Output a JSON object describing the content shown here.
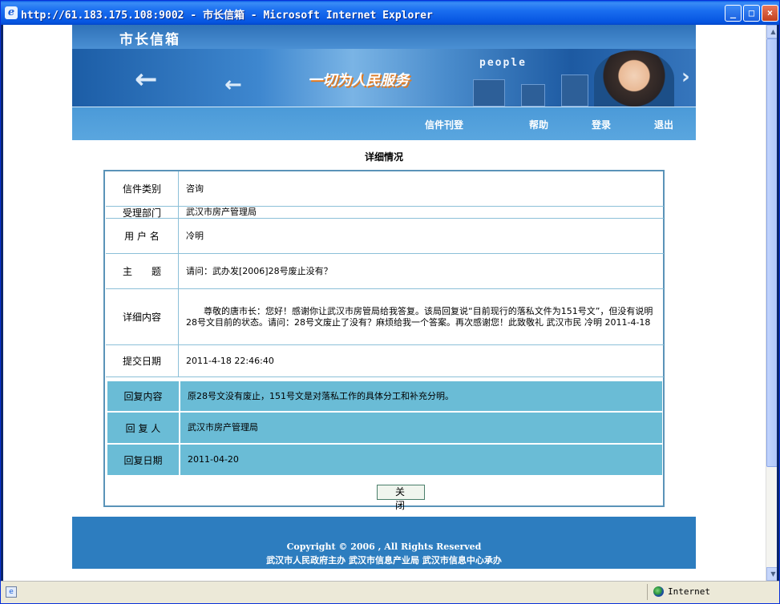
{
  "window": {
    "title": "http://61.183.175.108:9002 - 市长信箱 - Microsoft Internet Explorer",
    "min_label": "_",
    "max_label": "□",
    "close_label": "×"
  },
  "banner": {
    "site_title": "市长信箱",
    "slogan": "一切为人民服务",
    "people_text": "people"
  },
  "nav": {
    "items": [
      {
        "label": "信件刊登"
      },
      {
        "label": "帮助"
      },
      {
        "label": "登录"
      },
      {
        "label": "退出"
      }
    ]
  },
  "detail": {
    "heading": "详细情况",
    "rows": [
      {
        "label": "信件类别",
        "value": "咨询"
      },
      {
        "label": "受理部门",
        "value": "武汉市房产管理局"
      },
      {
        "label": "用 户 名",
        "value": "冷明"
      },
      {
        "label": "主　　题",
        "value": "请问：武办发[2006]28号废止没有？"
      },
      {
        "label": "详细内容",
        "value": "　　尊敬的唐市长：您好！感谢你让武汉市房管局给我答复。该局回复说“目前现行的落私文件为151号文”，但没有说明28号文目前的状态。请问：28号文废止了没有？麻烦给我一个答案。再次感谢您！此致敬礼 武汉市民 冷明 2011-4-18"
      },
      {
        "label": "提交日期",
        "value": "2011-4-18 22:46:40"
      }
    ],
    "replies": [
      {
        "label": "回复内容",
        "value": "原28号文没有废止，151号文是对落私工作的具体分工和补充分明。"
      },
      {
        "label": "回 复 人",
        "value": "武汉市房产管理局"
      },
      {
        "label": "回复日期",
        "value": "2011-04-20"
      }
    ],
    "close_label": "关 闭"
  },
  "footer": {
    "copyright": "Copyright © 2006 , All Rights Reserved",
    "host": "武汉市人民政府主办  武汉市信息产业局  武汉市信息中心承办"
  },
  "status": {
    "zone": "Internet"
  },
  "colors": {
    "titlebar": "#0a5ce6",
    "nav": "#4b9ad8",
    "reply_bg": "#6abcd6",
    "footer": "#2d7dbf"
  }
}
